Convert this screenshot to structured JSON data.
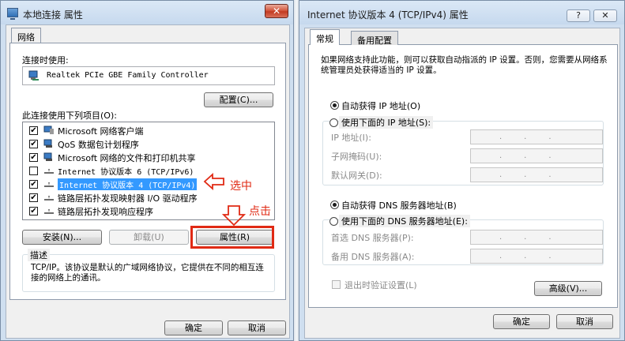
{
  "left_window": {
    "title": "本地连接 属性",
    "close_label": "✕",
    "tab": "网络",
    "connect_using_label": "连接时使用:",
    "adapter": "Realtek PCIe GBE Family Controller",
    "configure_label": "配置(C)...",
    "items_label": "此连接使用下列项目(O):",
    "items": [
      {
        "label": "Microsoft 网络客户端",
        "checked": "✔"
      },
      {
        "label": "QoS 数据包计划程序",
        "checked": "✔"
      },
      {
        "label": "Microsoft 网络的文件和打印机共享",
        "checked": "✔"
      },
      {
        "label": "Internet 协议版本 6 (TCP/IPv6)",
        "checked": ""
      },
      {
        "label": "Internet 协议版本 4 (TCP/IPv4)",
        "checked": "✔"
      },
      {
        "label": "链路层拓扑发现映射器 I/O 驱动程序",
        "checked": "✔"
      },
      {
        "label": "链路层拓扑发现响应程序",
        "checked": "✔"
      }
    ],
    "install_label": "安装(N)...",
    "uninstall_label": "卸载(U)",
    "properties_label": "属性(R)",
    "description_title": "描述",
    "description_text": "TCP/IP。该协议是默认的广域网络协议，它提供在不同的相互连接的网络上的通讯。",
    "ok_label": "确定",
    "cancel_label": "取消",
    "annotation_select": "选中",
    "annotation_click": "点击",
    "annotation_color": "#e02a14"
  },
  "right_window": {
    "title": "Internet 协议版本 4 (TCP/IPv4) 属性",
    "help_label": "?",
    "close_label": "✕",
    "tab_general": "常规",
    "tab_alternate": "备用配置",
    "intro_text": "如果网络支持此功能，则可以获取自动指派的 IP 设置。否则，您需要从网络系统管理员处获得适当的 IP 设置。",
    "auto_ip_label": "自动获得 IP 地址(O)",
    "manual_ip_label": "使用下面的 IP 地址(S):",
    "ip_address_label": "IP 地址(I):",
    "subnet_label": "子网掩码(U):",
    "gateway_label": "默认网关(D):",
    "ip_dots": "...",
    "auto_dns_label": "自动获得 DNS 服务器地址(B)",
    "manual_dns_label": "使用下面的 DNS 服务器地址(E):",
    "preferred_dns_label": "首选 DNS 服务器(P):",
    "alternate_dns_label": "备用 DNS 服务器(A):",
    "validate_label": "退出时验证设置(L)",
    "advanced_label": "高级(V)...",
    "ok_label": "确定",
    "cancel_label": "取消"
  }
}
